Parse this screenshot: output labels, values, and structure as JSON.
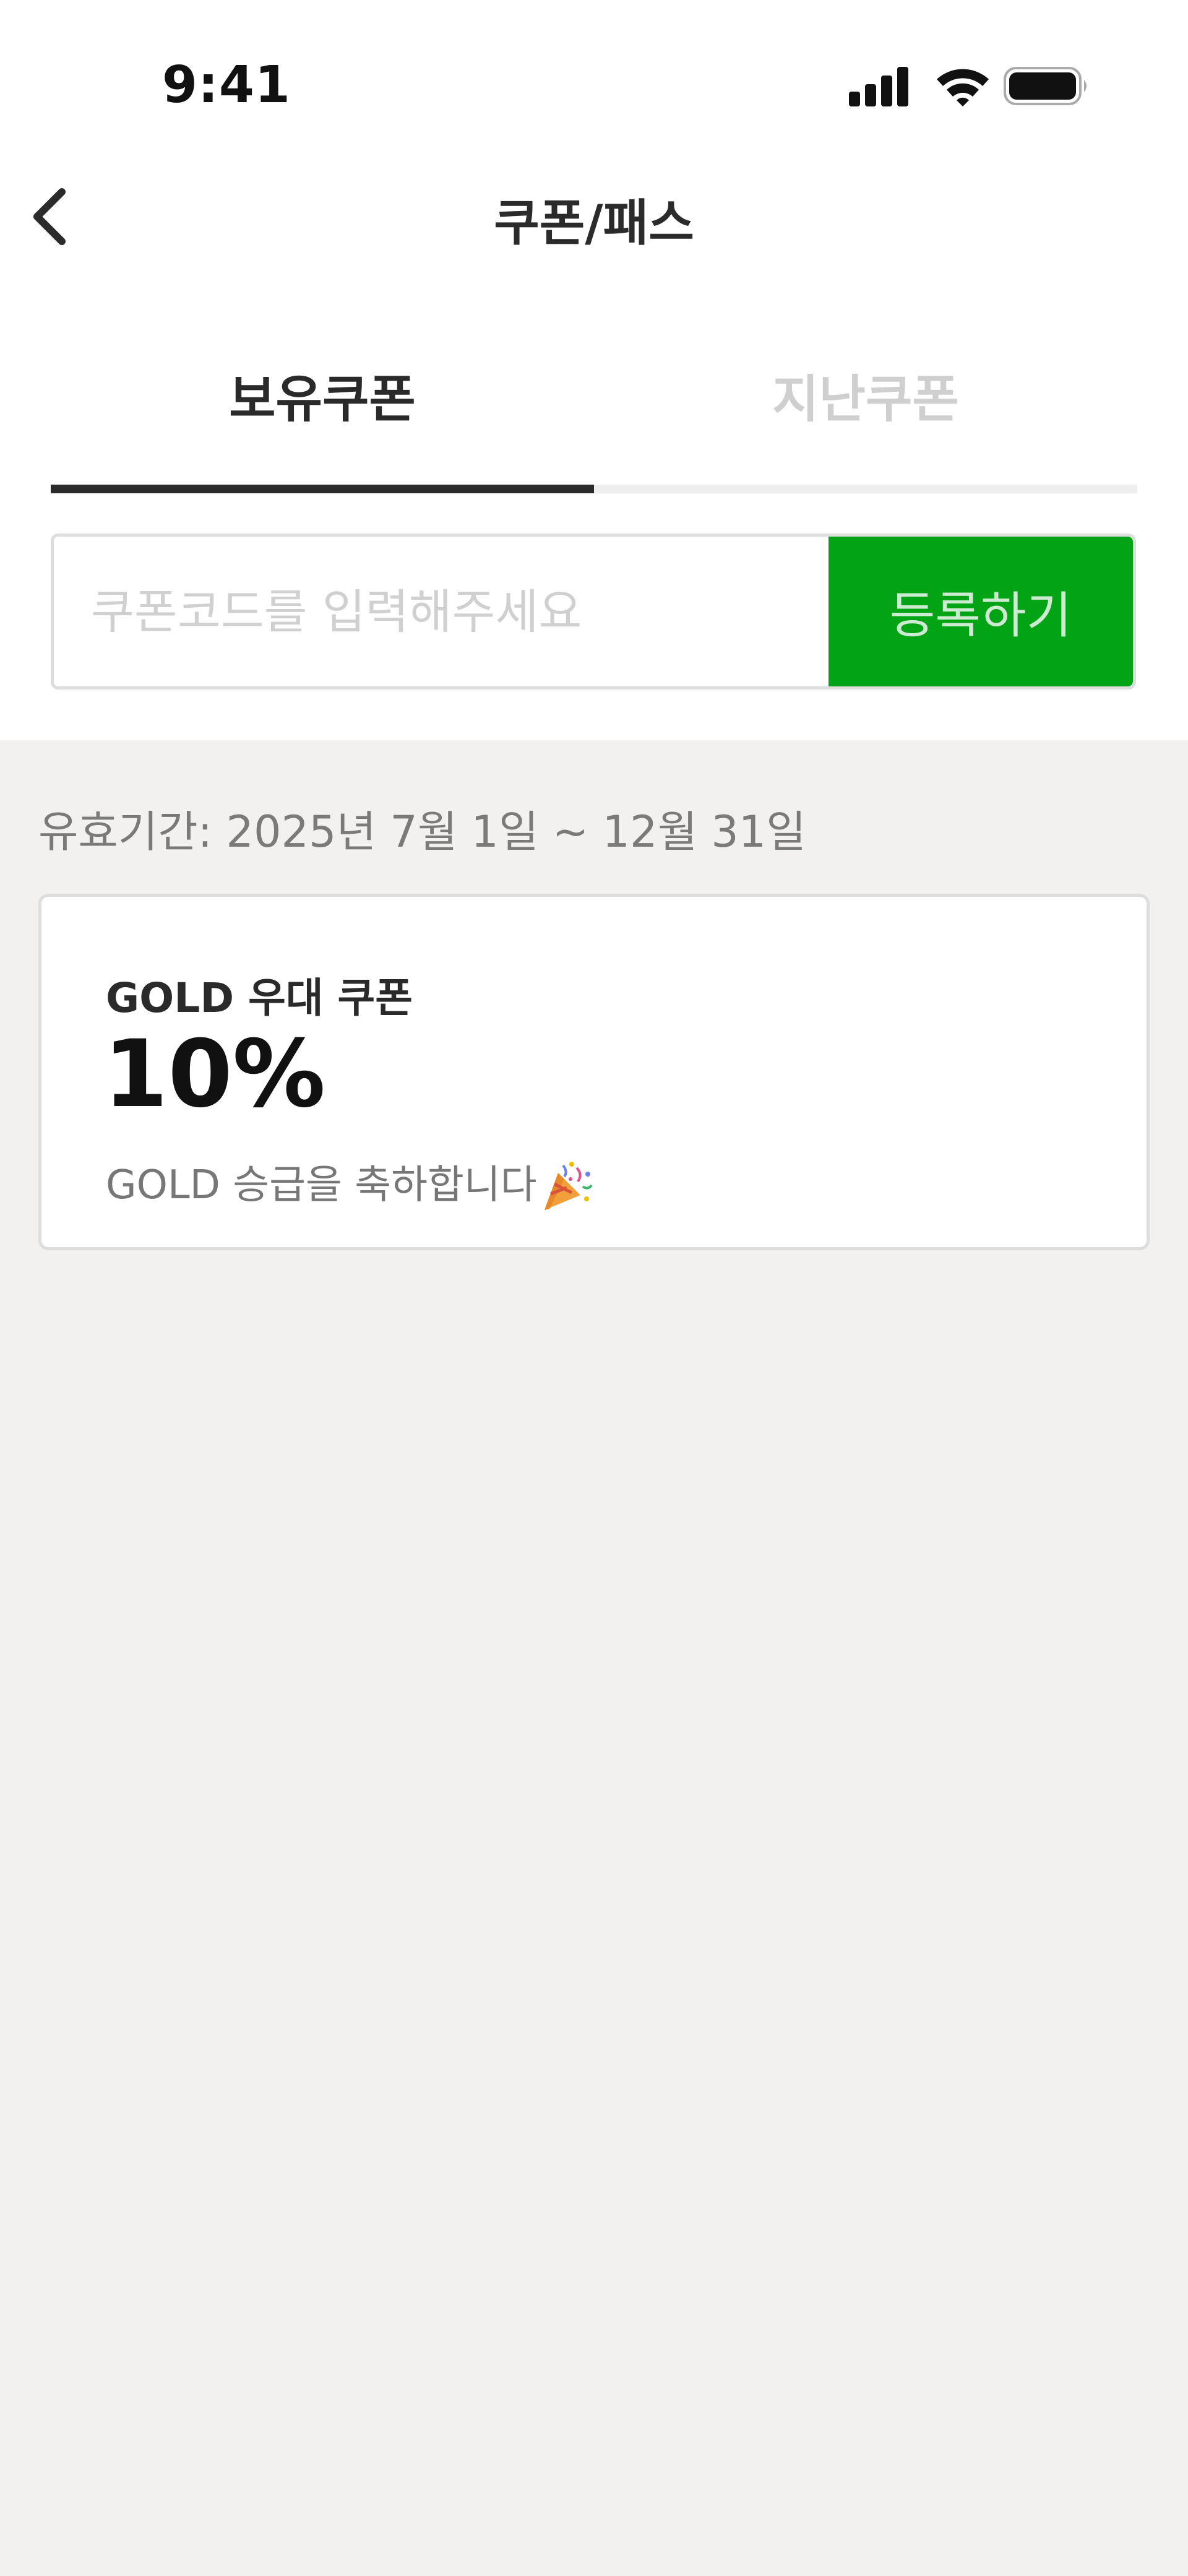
{
  "status_bar": {
    "time": "9:41",
    "icons": [
      "cellular-signal-icon",
      "wifi-icon",
      "battery-icon"
    ]
  },
  "header": {
    "back_icon": "chevron-left-icon",
    "title": "쿠폰/패스"
  },
  "tabs": [
    {
      "label": "보유쿠폰",
      "active": true
    },
    {
      "label": "지난쿠폰",
      "active": false
    }
  ],
  "coupon_form": {
    "placeholder": "쿠폰코드를 입력해주세요",
    "value": "",
    "register_label": "등록하기"
  },
  "validity": "유효기간: 2025년 7월 1일 ~ 12월 31일",
  "coupons": [
    {
      "name": "GOLD 우대 쿠폰",
      "discount": "10%",
      "description": "GOLD 승급을 축하합니다",
      "description_icon": "party-popper-icon"
    }
  ],
  "colors": {
    "accent_green": "#03a316",
    "background": "#f2f1f0",
    "tab_indicator": "#2b2b2b"
  }
}
